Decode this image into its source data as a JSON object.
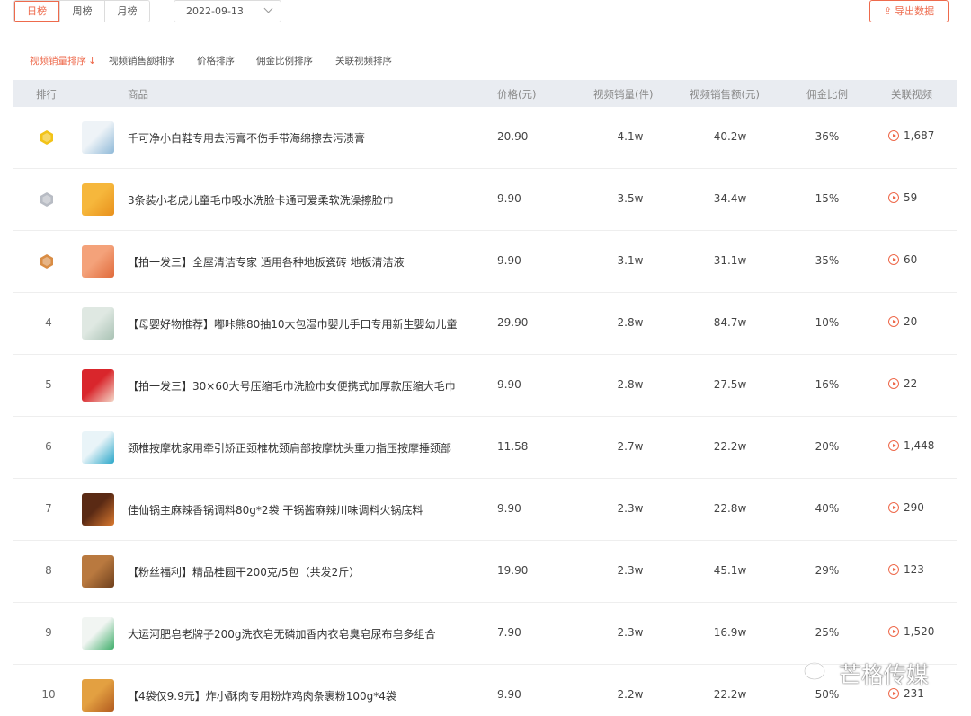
{
  "period_tabs": [
    {
      "label": "日榜",
      "active": true
    },
    {
      "label": "周榜",
      "active": false
    },
    {
      "label": "月榜",
      "active": false
    }
  ],
  "date_picker": {
    "value": "2022-09-13"
  },
  "export_button": {
    "label": "导出数据",
    "icon": "upload-icon"
  },
  "sort_tabs": [
    {
      "label": "视频销量排序",
      "active": true,
      "arrow": "↓"
    },
    {
      "label": "视频销售额排序",
      "active": false
    },
    {
      "label": "价格排序",
      "active": false
    },
    {
      "label": "佣金比例排序",
      "active": false
    },
    {
      "label": "关联视频排序",
      "active": false
    }
  ],
  "columns": [
    "排行",
    "商品",
    "价格(元)",
    "视频销量(件)",
    "视频销售额(元)",
    "佣金比例",
    "关联视频"
  ],
  "colors": {
    "accent": "#ee6a4c",
    "header_bg": "#e9ecf1",
    "gold": "#f2c318",
    "silver": "#b8bcc4",
    "bronze": "#d98d45"
  },
  "rows": [
    {
      "rank": "1",
      "medal": "gold",
      "title": "千可净小白鞋专用去污膏不伤手带海绵擦去污渍膏",
      "price": "20.90",
      "sales": "4.1w",
      "amount": "40.2w",
      "ratio": "36%",
      "videos": "1,687"
    },
    {
      "rank": "2",
      "medal": "silver",
      "title": "3条装小老虎儿童毛巾吸水洗脸卡通可爱柔软洗澡擦脸巾",
      "price": "9.90",
      "sales": "3.5w",
      "amount": "34.4w",
      "ratio": "15%",
      "videos": "59"
    },
    {
      "rank": "3",
      "medal": "bronze",
      "title": "【拍一发三】全屋清洁专家 适用各种地板瓷砖 地板清洁液",
      "price": "9.90",
      "sales": "3.1w",
      "amount": "31.1w",
      "ratio": "35%",
      "videos": "60"
    },
    {
      "rank": "4",
      "medal": "",
      "title": "【母婴好物推荐】嘟咔熊80抽10大包湿巾婴儿手口专用新生婴幼儿童",
      "price": "29.90",
      "sales": "2.8w",
      "amount": "84.7w",
      "ratio": "10%",
      "videos": "20"
    },
    {
      "rank": "5",
      "medal": "",
      "title": "【拍一发三】30×60大号压缩毛巾洗脸巾女便携式加厚款压缩大毛巾",
      "price": "9.90",
      "sales": "2.8w",
      "amount": "27.5w",
      "ratio": "16%",
      "videos": "22"
    },
    {
      "rank": "6",
      "medal": "",
      "title": "颈椎按摩枕家用牵引矫正颈椎枕颈肩部按摩枕头重力指压按摩捶颈部",
      "price": "11.58",
      "sales": "2.7w",
      "amount": "22.2w",
      "ratio": "20%",
      "videos": "1,448"
    },
    {
      "rank": "7",
      "medal": "",
      "title": "佳仙锅主麻辣香锅调料80g*2袋 干锅酱麻辣川味调料火锅底料",
      "price": "9.90",
      "sales": "2.3w",
      "amount": "22.8w",
      "ratio": "40%",
      "videos": "290"
    },
    {
      "rank": "8",
      "medal": "",
      "title": "【粉丝福利】精品桂圆干200克/5包（共发2斤）",
      "price": "19.90",
      "sales": "2.3w",
      "amount": "45.1w",
      "ratio": "29%",
      "videos": "123"
    },
    {
      "rank": "9",
      "medal": "",
      "title": "大运河肥皂老牌子200g洗衣皂无磷加香内衣皂臭皂尿布皂多组合",
      "price": "7.90",
      "sales": "2.3w",
      "amount": "16.9w",
      "ratio": "25%",
      "videos": "1,520"
    },
    {
      "rank": "10",
      "medal": "",
      "title": "【4袋仅9.9元】炸小酥肉专用粉炸鸡肉条裹粉100g*4袋",
      "price": "9.90",
      "sales": "2.2w",
      "amount": "22.2w",
      "ratio": "50%",
      "videos": "231"
    }
  ],
  "watermark": {
    "text": "芒格传媒",
    "icon": "wechat-icon"
  }
}
